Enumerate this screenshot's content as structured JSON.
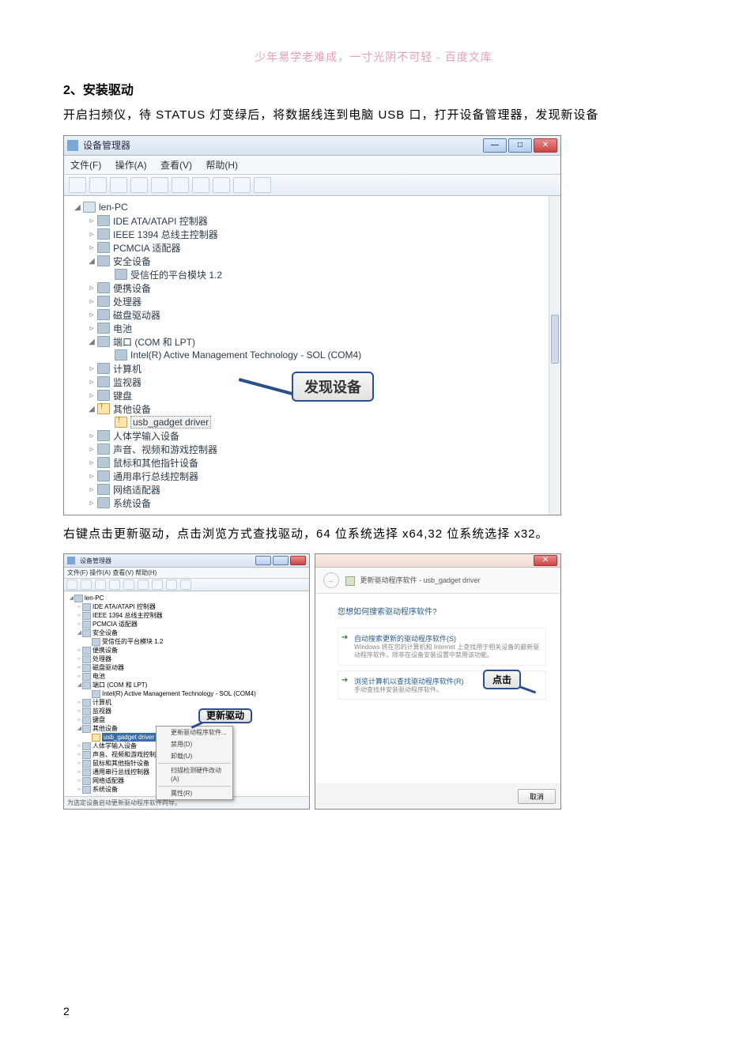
{
  "watermark": "少年易学老难成，一寸光阴不可轻 - 百度文库",
  "page_number": "2",
  "section_heading": "2、安装驱动",
  "paragraph1": "开启扫频仪，待 STATUS 灯变绿后，将数据线连到电脑 USB 口，打开设备管理器，发现新设备",
  "paragraph2": "右键点击更新驱动，点击浏览方式查找驱动，64 位系统选择 x64,32 位系统选择 x32。",
  "devmgr": {
    "title": "设备管理器",
    "menus": {
      "file": "文件(F)",
      "action": "操作(A)",
      "view": "查看(V)",
      "help": "帮助(H)"
    },
    "root": "len-PC",
    "nodes": [
      {
        "exp": "▹",
        "label": "IDE ATA/ATAPI 控制器"
      },
      {
        "exp": "▹",
        "label": "IEEE 1394 总线主控制器"
      },
      {
        "exp": "▹",
        "label": "PCMCIA 适配器"
      },
      {
        "exp": "◢",
        "label": "安全设备",
        "children": [
          {
            "label": "受信任的平台模块 1.2"
          }
        ]
      },
      {
        "exp": "▹",
        "label": "便携设备"
      },
      {
        "exp": "▹",
        "label": "处理器"
      },
      {
        "exp": "▹",
        "label": "磁盘驱动器"
      },
      {
        "exp": "▹",
        "label": "电池"
      },
      {
        "exp": "◢",
        "label": "端口 (COM 和 LPT)",
        "children": [
          {
            "label": "Intel(R) Active Management Technology - SOL (COM4)"
          }
        ]
      },
      {
        "exp": "▹",
        "label": "计算机"
      },
      {
        "exp": "▹",
        "label": "监视器"
      },
      {
        "exp": "▹",
        "label": "键盘"
      },
      {
        "exp": "◢",
        "label": "其他设备",
        "hl": true,
        "children": [
          {
            "label": "usb_gadget driver",
            "warn": true,
            "sel": true
          }
        ]
      },
      {
        "exp": "▹",
        "label": "人体学输入设备"
      },
      {
        "exp": "▹",
        "label": "声音、视频和游戏控制器"
      },
      {
        "exp": "▹",
        "label": "鼠标和其他指针设备"
      },
      {
        "exp": "▹",
        "label": "通用串行总线控制器"
      },
      {
        "exp": "▹",
        "label": "网络适配器"
      },
      {
        "exp": "▹",
        "label": "系统设备"
      }
    ],
    "callout": "发现设备"
  },
  "mini_devmgr": {
    "title": "设备管理器",
    "menus": "文件(F)  操作(A)  查看(V)  帮助(H)",
    "root": "len-PC",
    "nodes": [
      "IDE ATA/ATAPI 控制器",
      "IEEE 1394 总线主控制器",
      "PCMCIA 适配器",
      "安全设备",
      "受信任的平台模块 1.2",
      "便携设备",
      "处理器",
      "磁盘驱动器",
      "电池",
      "端口 (COM 和 LPT)",
      "Intel(R) Active Management Technology - SOL (COM4)",
      "计算机",
      "监视器",
      "键盘",
      "其他设备",
      "usb_gadget driver",
      "人体学输入设备",
      "声音、视频和游戏控制器",
      "鼠标和其他指针设备",
      "通用串行总线控制器",
      "网络适配器",
      "系统设备"
    ],
    "context_menu": [
      "更新驱动程序软件...",
      "禁用(D)",
      "卸载(U)",
      "扫描检测硬件改动(A)",
      "属性(R)"
    ],
    "callout": "更新驱动",
    "status": "为选定设备启动更新驱动程序软件向导。"
  },
  "wizard": {
    "crumb_prefix": "更新驱动程序软件 - ",
    "crumb_device": "usb_gadget driver",
    "question": "您想如何搜索驱动程序软件?",
    "opt1_title": "自动搜索更新的驱动程序软件(S)",
    "opt1_desc": "Windows 将在您的计算机和 Internet 上查找用于相关设备的最新驱动程序软件，除非在设备安装设置中禁用该功能。",
    "opt2_title": "浏览计算机以查找驱动程序软件(R)",
    "opt2_desc": "手动查找并安装驱动程序软件。",
    "callout": "点击",
    "cancel": "取消"
  }
}
